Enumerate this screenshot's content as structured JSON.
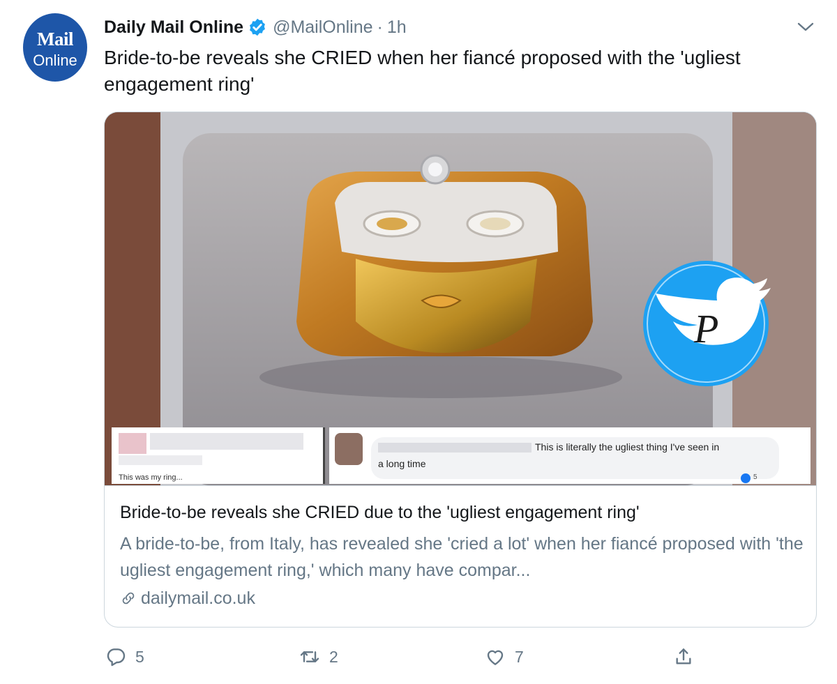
{
  "account": {
    "avatar_line1": "Mail",
    "avatar_line2": "Online",
    "name": "Daily Mail Online",
    "handle": "@MailOnline",
    "separator": "·",
    "time": "1h"
  },
  "tweet": {
    "text": "Bride-to-be reveals she CRIED when her fiancé proposed with the 'ugliest engagement ring'"
  },
  "image_overlay": {
    "watermark_letter": "P",
    "comment_left_text": "This was my ring...",
    "comment_right_line1": "This is literally the ugliest thing I've seen in",
    "comment_right_line2": "a long time",
    "reaction_count": "5"
  },
  "card": {
    "title": "Bride-to-be reveals she CRIED due to the 'ugliest engagement ring'",
    "description": "A bride-to-be, from Italy, has revealed she 'cried a lot' when her fiancé proposed with 'the ugliest engagement ring,' which many have compar...",
    "link": "dailymail.co.uk"
  },
  "actions": {
    "replies": "5",
    "retweets": "2",
    "likes": "7"
  },
  "colors": {
    "brand_blue": "#1e56a8",
    "twitter_blue": "#1da1f2",
    "secondary_text": "#657786",
    "gold": "#c98a2e"
  },
  "icons": [
    "verified-icon",
    "chevron-down-icon",
    "link-icon",
    "reply-icon",
    "retweet-icon",
    "like-icon",
    "share-icon",
    "twitter-bird-icon"
  ]
}
